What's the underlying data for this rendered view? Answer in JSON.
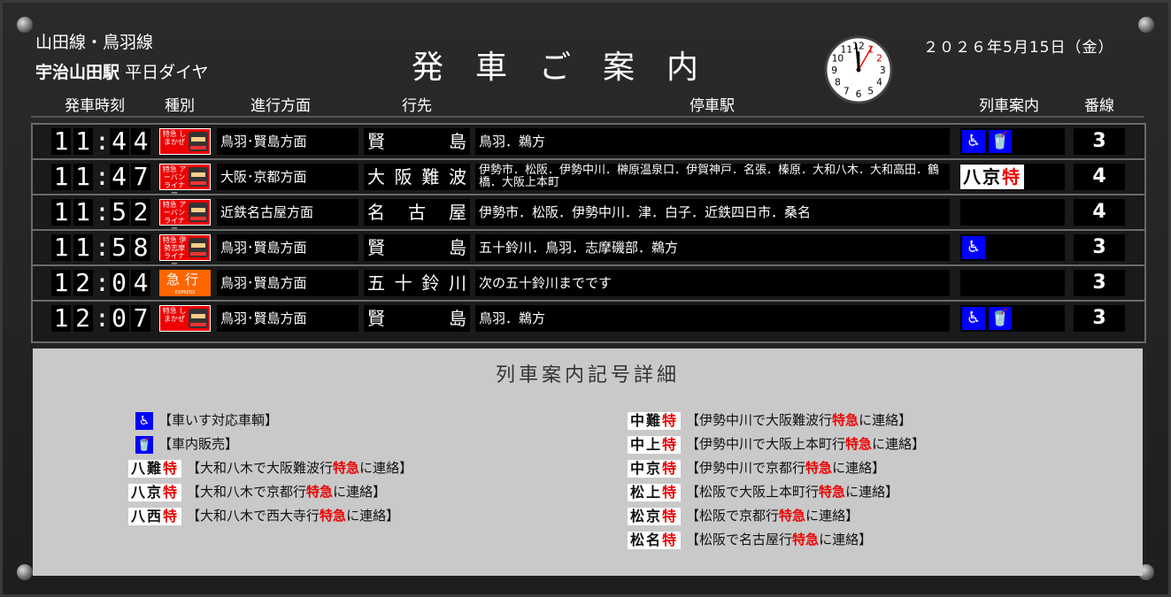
{
  "header": {
    "line_name": "山田線・鳥羽線",
    "station": "宇治山田駅",
    "schedule": "平日ダイヤ",
    "title": "発車ご案内",
    "date": "２０２６年5月15日（金）"
  },
  "columns": {
    "time": "発車時刻",
    "type": "種別",
    "direction": "進行方面",
    "destination": "行先",
    "stops": "停車駅",
    "info": "列車案内",
    "track": "番線"
  },
  "rows": [
    {
      "h1": "1",
      "h2": "1",
      "m1": "4",
      "m2": "4",
      "type_label": "特急 しまかぜ",
      "type_kind": "ltd",
      "direction": "鳥羽･賢島方面",
      "destination": "賢 島",
      "stops": "鳥羽．鵜方",
      "info": "wheelchair-icon+shop-icon",
      "track": "3"
    },
    {
      "h1": "1",
      "h2": "1",
      "m1": "4",
      "m2": "7",
      "type_label": "特急 アーバンライナー",
      "type_kind": "ltd",
      "direction": "大阪･京都方面",
      "destination": "大阪難波",
      "stops": "伊勢市．松阪．伊勢中川．榊原温泉口．伊賀神戸．名張．榛原．大和八木．大和高田．鶴橋．大阪上本町",
      "info": "八京特",
      "track": "4"
    },
    {
      "h1": "1",
      "h2": "1",
      "m1": "5",
      "m2": "2",
      "type_label": "特急 アーバンライナー",
      "type_kind": "ltd",
      "direction": "近鉄名古屋方面",
      "destination": "名古屋",
      "stops": "伊勢市．松阪．伊勢中川．津．白子．近鉄四日市．桑名",
      "info": "",
      "track": "4"
    },
    {
      "h1": "1",
      "h2": "1",
      "m1": "5",
      "m2": "8",
      "type_label": "特急 伊勢志摩ライナー",
      "type_kind": "ltd",
      "direction": "鳥羽･賢島方面",
      "destination": "賢 島",
      "stops": "五十鈴川．鳥羽．志摩磯部．鵜方",
      "info": "wheelchair-icon",
      "track": "3"
    },
    {
      "h1": "1",
      "h2": "2",
      "m1": "0",
      "m2": "4",
      "type_label": "急行",
      "type_kind": "exp",
      "direction": "鳥羽･賢島方面",
      "destination": "五十鈴川",
      "stops": "次の五十鈴川までです",
      "info": "",
      "track": "3"
    },
    {
      "h1": "1",
      "h2": "2",
      "m1": "0",
      "m2": "7",
      "type_label": "特急 しまかぜ",
      "type_kind": "ltd",
      "direction": "鳥羽･賢島方面",
      "destination": "賢 島",
      "stops": "鳥羽．鵜方",
      "info": "wheelchair-icon+shop-icon",
      "track": "3"
    }
  ],
  "legend": {
    "title": "列車案内記号詳細",
    "left": [
      {
        "icon": "wheelchair-icon",
        "glyph": "♿",
        "text": "【車いす対応車輌】"
      },
      {
        "icon": "shop-icon",
        "glyph": "🥤",
        "text": "【車内販売】"
      },
      {
        "badge": "八難",
        "text_a": "【大和八木で大阪難波行",
        "text_b": "特急",
        "text_c": "に連絡】"
      },
      {
        "badge": "八京",
        "text_a": "【大和八木で京都行",
        "text_b": "特急",
        "text_c": "に連絡】"
      },
      {
        "badge": "八西",
        "text_a": "【大和八木で西大寺行",
        "text_b": "特急",
        "text_c": "に連絡】"
      }
    ],
    "right": [
      {
        "badge": "中難",
        "text_a": "【伊勢中川で大阪難波行",
        "text_b": "特急",
        "text_c": "に連絡】"
      },
      {
        "badge": "中上",
        "text_a": "【伊勢中川で大阪上本町行",
        "text_b": "特急",
        "text_c": "に連絡】"
      },
      {
        "badge": "中京",
        "text_a": "【伊勢中川で京都行",
        "text_b": "特急",
        "text_c": "に連絡】"
      },
      {
        "badge": "松上",
        "text_a": "【松阪で大阪上本町行",
        "text_b": "特急",
        "text_c": "に連絡】"
      },
      {
        "badge": "松京",
        "text_a": "【松阪で京都行",
        "text_b": "特急",
        "text_c": "に連絡】"
      },
      {
        "badge": "松名",
        "text_a": "【松阪で名古屋行",
        "text_b": "特急",
        "text_c": "に連絡】"
      }
    ],
    "badge_suffix": "特"
  },
  "clock": {
    "hour": 11,
    "minute": 59,
    "second": 5
  },
  "colors": {
    "board": "#1e1e1e",
    "accent_red": "#ee0000",
    "icon_blue": "#0000ff",
    "express_orange": "#ff6600"
  }
}
